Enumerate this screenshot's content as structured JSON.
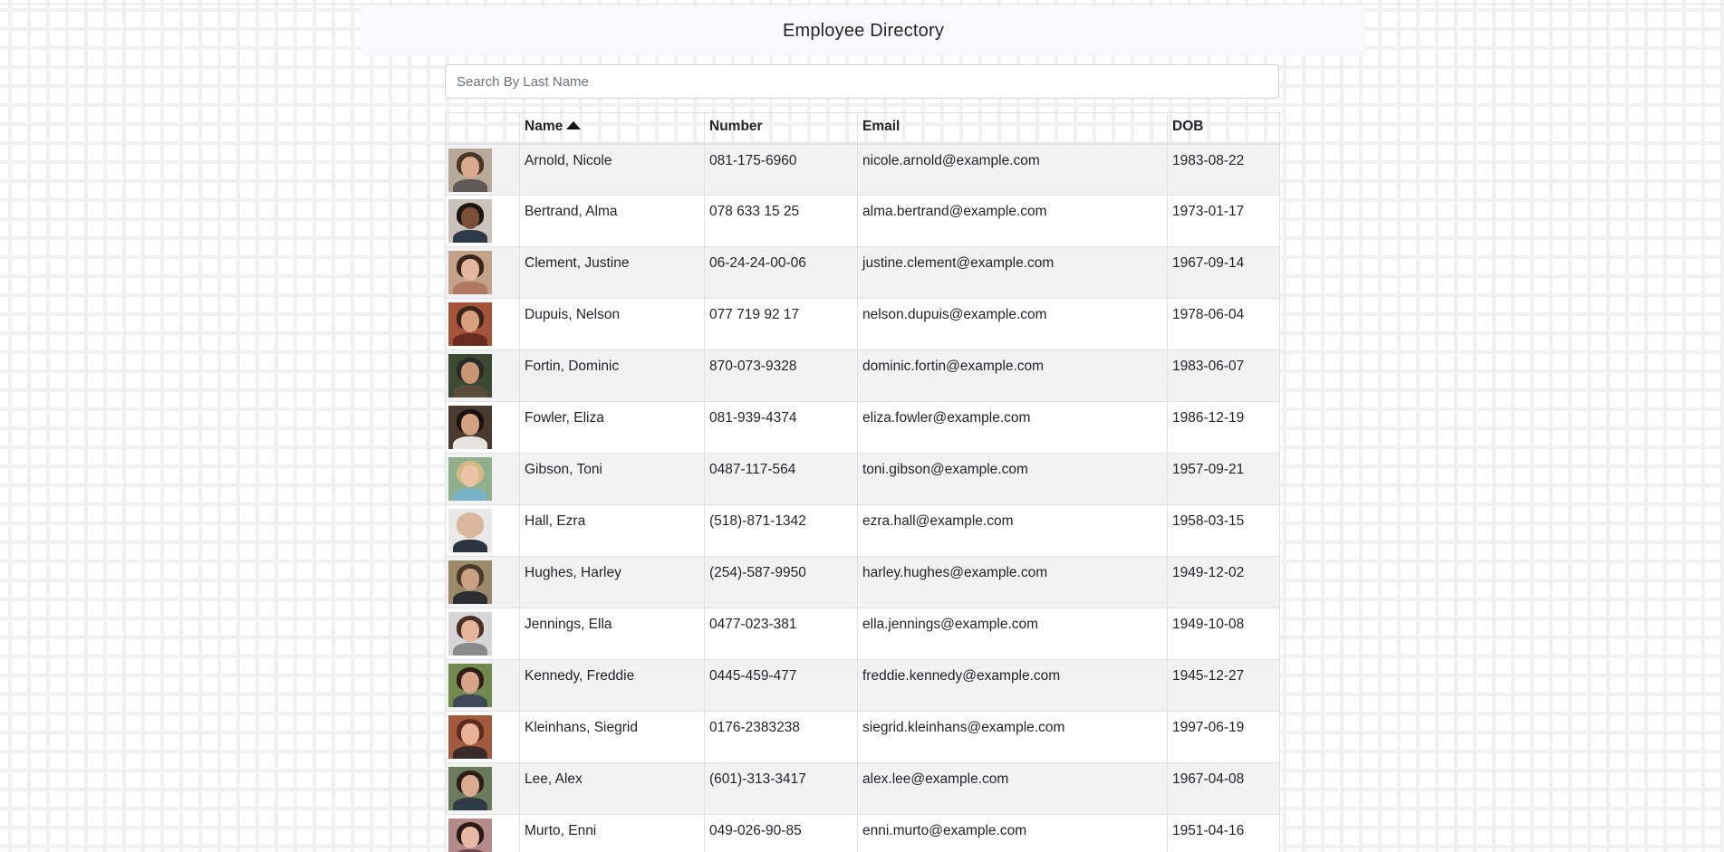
{
  "header": {
    "title": "Employee Directory"
  },
  "search": {
    "placeholder": "Search By Last Name",
    "value": ""
  },
  "table": {
    "columns": {
      "image": "",
      "name": "Name",
      "number": "Number",
      "email": "Email",
      "dob": "DOB"
    },
    "sort": {
      "column": "name",
      "direction": "ascending"
    },
    "rows": [
      {
        "name": "Arnold, Nicole",
        "number": "081-175-6960",
        "email": "nicole.arnold@example.com",
        "dob": "1983-08-22",
        "avatar": {
          "bg": "#b7aa98",
          "hair": "#4a3425",
          "skin": "#d9a98c",
          "shirt": "#5f5a58"
        }
      },
      {
        "name": "Bertrand, Alma",
        "number": "078 633 15 25",
        "email": "alma.bertrand@example.com",
        "dob": "1973-01-17",
        "avatar": {
          "bg": "#c9c3bb",
          "hair": "#1e1612",
          "skin": "#7a4f37",
          "shirt": "#2e3a4a"
        }
      },
      {
        "name": "Clement, Justine",
        "number": "06-24-24-00-06",
        "email": "justine.clement@example.com",
        "dob": "1967-09-14",
        "avatar": {
          "bg": "#c4a28a",
          "hair": "#3b2418",
          "skin": "#e4b8a0",
          "shirt": "#b07a62"
        }
      },
      {
        "name": "Dupuis, Nelson",
        "number": "077 719 92 17",
        "email": "nelson.dupuis@example.com",
        "dob": "1978-06-04",
        "avatar": {
          "bg": "#a4523a",
          "hair": "#3a2318",
          "skin": "#d9a07e",
          "shirt": "#6a2e21"
        }
      },
      {
        "name": "Fortin, Dominic",
        "number": "870-073-9328",
        "email": "dominic.fortin@example.com",
        "dob": "1983-06-07",
        "avatar": {
          "bg": "#3c4a34",
          "hair": "#2a2a26",
          "skin": "#c99474",
          "shirt": "#5a4c3a"
        }
      },
      {
        "name": "Fowler, Eliza",
        "number": "081-939-4374",
        "email": "eliza.fowler@example.com",
        "dob": "1986-12-19",
        "avatar": {
          "bg": "#4a3a2f",
          "hair": "#1a120e",
          "skin": "#d3a283",
          "shirt": "#e8e4df"
        }
      },
      {
        "name": "Gibson, Toni",
        "number": "0487-117-564",
        "email": "toni.gibson@example.com",
        "dob": "1957-09-21",
        "avatar": {
          "bg": "#8fb08a",
          "hair": "#d3b985",
          "skin": "#eac3a6",
          "shirt": "#7ab3c6"
        }
      },
      {
        "name": "Hall, Ezra",
        "number": "(518)-871-1342",
        "email": "ezra.hall@example.com",
        "dob": "1958-03-15",
        "avatar": {
          "bg": "#e9e9e9",
          "hair": "#d8b79c",
          "skin": "#d8b79c",
          "shirt": "#2c3440"
        }
      },
      {
        "name": "Hughes, Harley",
        "number": "(254)-587-9950",
        "email": "harley.hughes@example.com",
        "dob": "1949-12-02",
        "avatar": {
          "bg": "#9a8a6a",
          "hair": "#4a3a2a",
          "skin": "#c9a183",
          "shirt": "#2c2e30"
        }
      },
      {
        "name": "Jennings, Ella",
        "number": "0477-023-381",
        "email": "ella.jennings@example.com",
        "dob": "1949-10-08",
        "avatar": {
          "bg": "#d6d6d6",
          "hair": "#4a3026",
          "skin": "#e3b59b",
          "shirt": "#8a8a8a"
        }
      },
      {
        "name": "Kennedy, Freddie",
        "number": "0445-459-477",
        "email": "freddie.kennedy@example.com",
        "dob": "1945-12-27",
        "avatar": {
          "bg": "#6f8a4c",
          "hair": "#2d1d16",
          "skin": "#d6a487",
          "shirt": "#3e4a5a"
        }
      },
      {
        "name": "Kleinhans, Siegrid",
        "number": "0176-2383238",
        "email": "siegrid.kleinhans@example.com",
        "dob": "1997-06-19",
        "avatar": {
          "bg": "#a35a3e",
          "hair": "#5a2c1c",
          "skin": "#e8b197",
          "shirt": "#3a2b2b"
        }
      },
      {
        "name": "Lee, Alex",
        "number": "(601)-313-3417",
        "email": "alex.lee@example.com",
        "dob": "1967-04-08",
        "avatar": {
          "bg": "#6a7a5a",
          "hair": "#2a1e18",
          "skin": "#d9aa8d",
          "shirt": "#2e3a44"
        }
      },
      {
        "name": "Murto, Enni",
        "number": "049-026-90-85",
        "email": "enni.murto@example.com",
        "dob": "1951-04-16",
        "avatar": {
          "bg": "#b48a8a",
          "hair": "#2a1a16",
          "skin": "#e7b9a4",
          "shirt": "#6e4450"
        }
      }
    ]
  }
}
